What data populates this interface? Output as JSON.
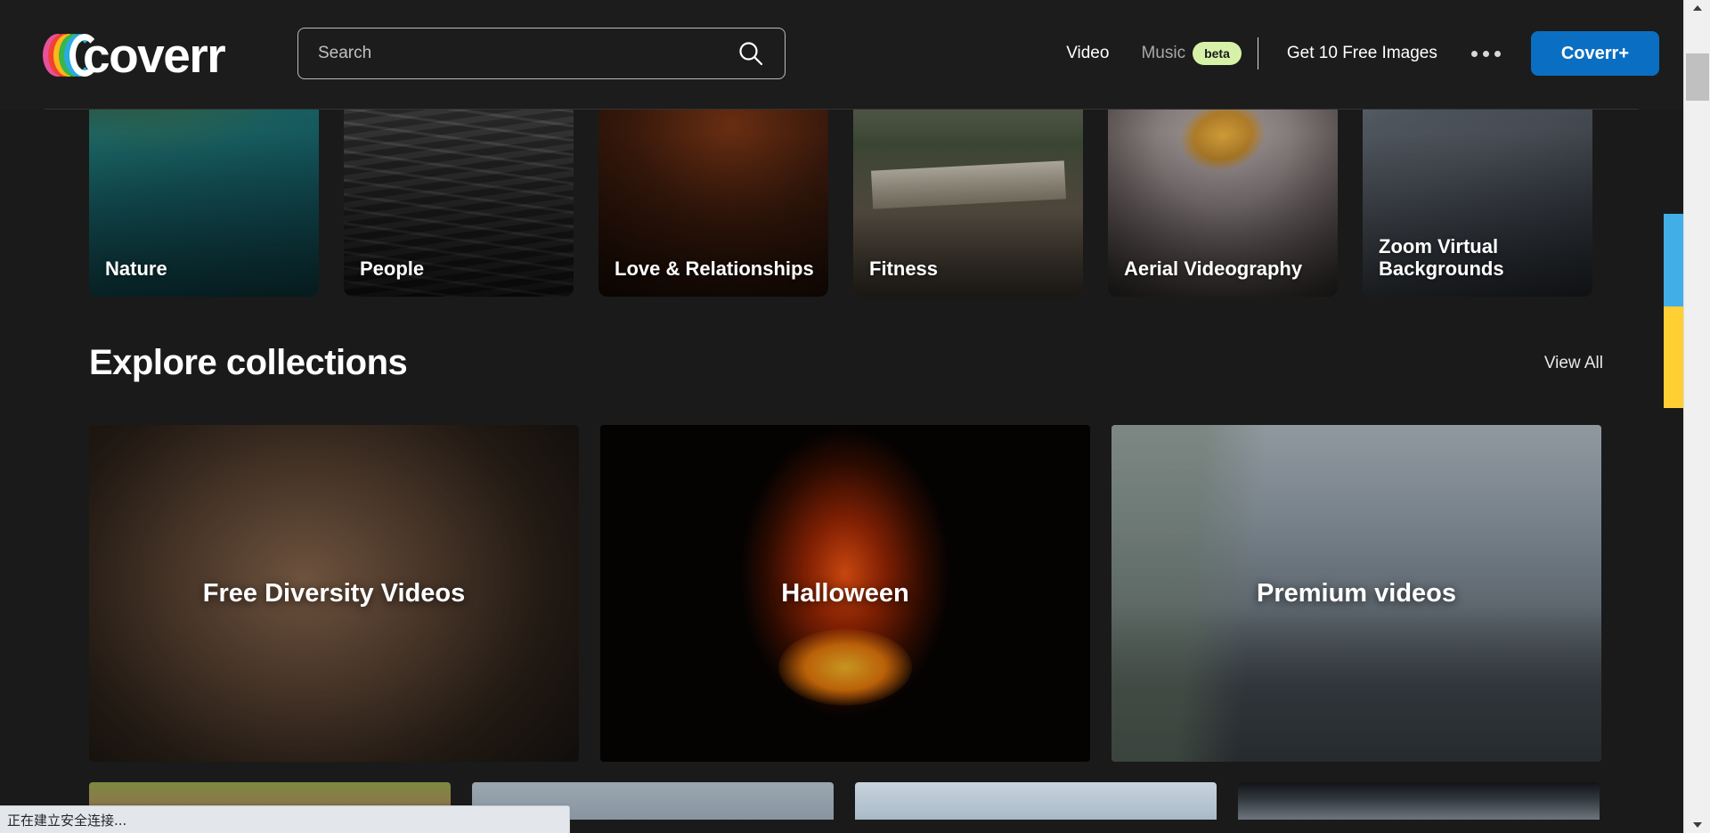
{
  "site": {
    "logo_text": "coverr",
    "accent_blue": "#0a6fc2",
    "badge_green": "#d6f2a8",
    "background": "#1a1a1a"
  },
  "search": {
    "placeholder": "Search",
    "value": "",
    "icon": "search-icon"
  },
  "nav": {
    "items": [
      {
        "label": "Video",
        "active": true
      },
      {
        "label": "Music",
        "active": false,
        "badge": "beta"
      },
      {
        "label": "Get 10 Free Images",
        "active": true
      }
    ],
    "video_label": "Video",
    "music_label": "Music",
    "music_badge": "beta",
    "free_images_label": "Get 10 Free Images",
    "more_icon": "ellipsis-icon",
    "cta_label": "Coverr+"
  },
  "categories": [
    {
      "label": "Nature",
      "image_class": "im-nature"
    },
    {
      "label": "People",
      "image_class": "im-people"
    },
    {
      "label": "Love & Relationships",
      "image_class": "im-love"
    },
    {
      "label": "Fitness",
      "image_class": "im-fitness"
    },
    {
      "label": "Aerial Videography",
      "image_class": "im-aerial"
    },
    {
      "label": "Zoom Virtual Backgrounds",
      "image_class": "im-zoom"
    }
  ],
  "explore": {
    "title": "Explore collections",
    "view_all_label": "View All",
    "collections": [
      {
        "title": "Free Diversity Videos"
      },
      {
        "title": "Halloween"
      },
      {
        "title": "Premium videos"
      }
    ]
  },
  "browser": {
    "status_text": "正在建立安全连接...",
    "scrollbar": {
      "up_arrow": "scroll-up-icon",
      "down_arrow": "scroll-down-icon",
      "thumb_position_percent": 6
    }
  },
  "edge_bars": {
    "blue": "#42aee8",
    "yellow": "#ffcf33"
  }
}
